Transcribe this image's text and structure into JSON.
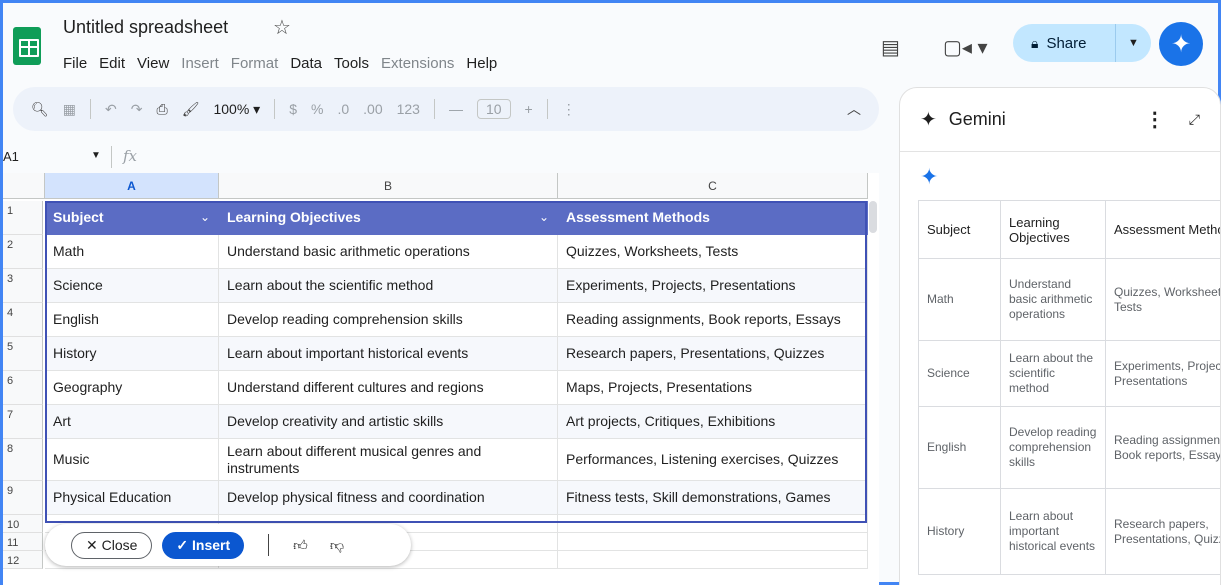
{
  "header": {
    "doc_title": "Untitled spreadsheet",
    "menu": [
      {
        "label": "File",
        "enabled": true
      },
      {
        "label": "Edit",
        "enabled": true
      },
      {
        "label": "View",
        "enabled": true
      },
      {
        "label": "Insert",
        "enabled": false
      },
      {
        "label": "Format",
        "enabled": false
      },
      {
        "label": "Data",
        "enabled": true
      },
      {
        "label": "Tools",
        "enabled": true
      },
      {
        "label": "Extensions",
        "enabled": false
      },
      {
        "label": "Help",
        "enabled": true
      }
    ],
    "share_label": "Share"
  },
  "toolbar": {
    "zoom": "100%",
    "currency": "$",
    "percent": "%",
    "dec_decrease": ".0",
    "dec_increase": ".00",
    "format_123": "123",
    "font_size": "10"
  },
  "formula_bar": {
    "name_box": "A1",
    "fx": "fx"
  },
  "grid": {
    "columns": [
      "A",
      "B",
      "C"
    ],
    "row_numbers": [
      "1",
      "2",
      "3",
      "4",
      "5",
      "6",
      "7",
      "8",
      "9",
      "10",
      "11",
      "12"
    ],
    "header_row": [
      "Subject",
      "Learning Objectives",
      "Assessment Methods"
    ],
    "rows": [
      [
        "Math",
        "Understand basic arithmetic operations",
        "Quizzes, Worksheets, Tests"
      ],
      [
        "Science",
        "Learn about the scientific method",
        "Experiments, Projects, Presentations"
      ],
      [
        "English",
        "Develop reading comprehension skills",
        "Reading assignments, Book reports, Essays"
      ],
      [
        "History",
        "Learn about important historical events",
        "Research papers, Presentations, Quizzes"
      ],
      [
        "Geography",
        "Understand different cultures and regions",
        "Maps, Projects, Presentations"
      ],
      [
        "Art",
        "Develop creativity and artistic skills",
        "Art projects, Critiques, Exhibitions"
      ],
      [
        "Music",
        "Learn about different musical genres and instruments",
        "Performances, Listening exercises, Quizzes"
      ],
      [
        "Physical Education",
        "Develop physical fitness and coordination",
        "Fitness tests, Skill demonstrations, Games"
      ]
    ]
  },
  "actionbar": {
    "close_label": "Close",
    "insert_label": "Insert"
  },
  "gemini": {
    "title": "Gemini",
    "table_header": [
      "Subject",
      "Learning Objectives",
      "Assessment Methods"
    ],
    "table_rows": [
      [
        "Math",
        "Understand basic arithmetic operations",
        "Quizzes, Worksheets, Tests"
      ],
      [
        "Science",
        "Learn about the scientific method",
        "Experiments, Projects, Presentations"
      ],
      [
        "English",
        "Develop reading comprehension skills",
        "Reading assignments, Book reports, Essays"
      ],
      [
        "History",
        "Learn about important historical events",
        "Research papers, Presentations, Quizzes"
      ]
    ]
  },
  "colors": {
    "accent": "#1a73e8",
    "table_header": "#5b6cc4",
    "sheets_green": "#0f9d58",
    "share_bg": "#c2e7ff"
  }
}
